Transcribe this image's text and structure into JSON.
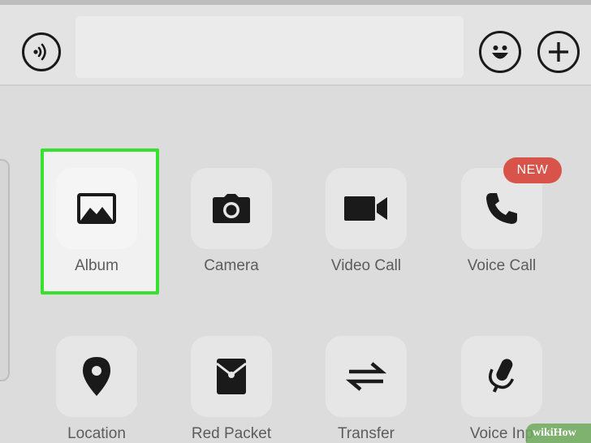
{
  "toolbar": {
    "voice_icon": "voice-wave-icon",
    "input_placeholder": "",
    "emoji_icon": "smiley-icon",
    "more_icon": "plus-icon"
  },
  "panel": {
    "items": [
      {
        "label": "Album",
        "icon": "image-icon",
        "highlighted": true
      },
      {
        "label": "Camera",
        "icon": "camera-icon"
      },
      {
        "label": "Video Call",
        "icon": "video-camera-icon"
      },
      {
        "label": "Voice Call",
        "icon": "phone-icon",
        "badge": "NEW"
      },
      {
        "label": "Location",
        "icon": "location-pin-icon"
      },
      {
        "label": "Red Packet",
        "icon": "red-packet-icon"
      },
      {
        "label": "Transfer",
        "icon": "transfer-arrows-icon"
      },
      {
        "label": "Voice Inp",
        "icon": "microphone-icon"
      }
    ]
  },
  "colors": {
    "highlight": "#38e030",
    "badge": "#d8534a"
  },
  "watermark": "wikiHow"
}
